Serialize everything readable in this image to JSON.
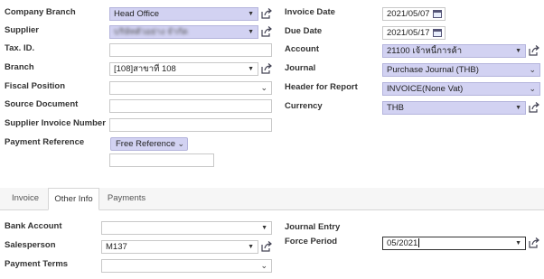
{
  "left_fields": {
    "company_branch": {
      "label": "Company Branch",
      "value": "Head Office"
    },
    "supplier": {
      "label": "Supplier",
      "value": "บริษัทตัวอย่าง จำกัด"
    },
    "tax_id": {
      "label": "Tax. ID.",
      "value": ""
    },
    "branch": {
      "label": "Branch",
      "value": "[108]สาขาที่ 108"
    },
    "fiscal_position": {
      "label": "Fiscal Position",
      "value": ""
    },
    "source_document": {
      "label": "Source Document",
      "value": ""
    },
    "supplier_invoice_number": {
      "label": "Supplier Invoice Number",
      "value": ""
    },
    "payment_reference": {
      "label": "Payment Reference",
      "value": "Free Reference",
      "extra_value": ""
    }
  },
  "right_fields": {
    "invoice_date": {
      "label": "Invoice Date",
      "value": "2021/05/07"
    },
    "due_date": {
      "label": "Due Date",
      "value": "2021/05/17"
    },
    "account": {
      "label": "Account",
      "value": "21100 เจ้าหนี้การค้า"
    },
    "journal": {
      "label": "Journal",
      "value": "Purchase Journal (THB)"
    },
    "header_for_report": {
      "label": "Header for Report",
      "value": "INVOICE(None Vat)"
    },
    "currency": {
      "label": "Currency",
      "value": "THB"
    }
  },
  "tabs": {
    "invoice": "Invoice",
    "other_info": "Other Info",
    "payments": "Payments",
    "active": "Other Info"
  },
  "other_info": {
    "bank_account": {
      "label": "Bank Account",
      "value": ""
    },
    "salesperson": {
      "label": "Salesperson",
      "value": "M137"
    },
    "payment_terms": {
      "label": "Payment Terms",
      "value": ""
    },
    "journal_entry": {
      "label": "Journal Entry",
      "value": ""
    },
    "force_period": {
      "label": "Force Period",
      "value": "05/2021"
    }
  },
  "colors": {
    "required_bg": "#d2d2f2",
    "tab_bar_bg": "#f6f6f6"
  },
  "icons": [
    "external-link-icon",
    "calendar-icon",
    "dropdown-arrow-icon",
    "chevron-down-icon"
  ]
}
